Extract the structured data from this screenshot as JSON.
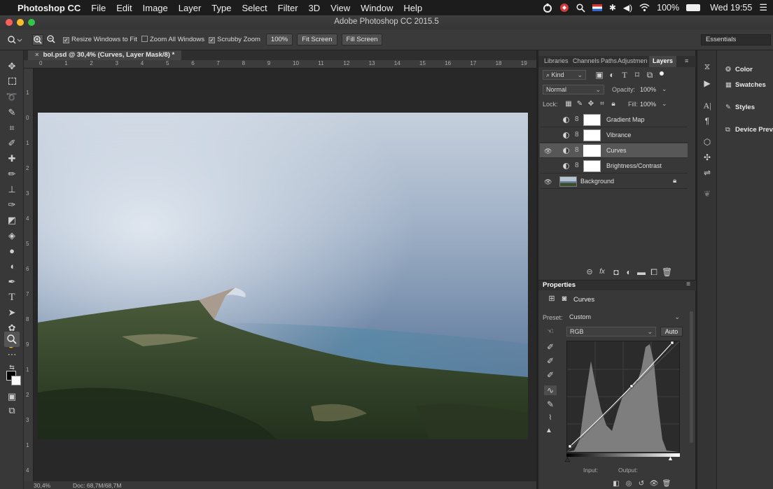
{
  "menubar": {
    "apple": "",
    "app_name": "Photoshop CC",
    "items": [
      "File",
      "Edit",
      "Image",
      "Layer",
      "Type",
      "Select",
      "Filter",
      "3D",
      "View",
      "Window",
      "Help"
    ],
    "battery": "100%",
    "clock": "Wed 19:55"
  },
  "window": {
    "title": "Adobe Photoshop CC 2015.5"
  },
  "options": {
    "resize_windows": "Resize Windows to Fit",
    "zoom_all": "Zoom All Windows",
    "scrubby": "Scrubby Zoom",
    "zoom_level": "100%",
    "fit_screen": "Fit Screen",
    "fill_screen": "Fill Screen",
    "workspace": "Essentials"
  },
  "document": {
    "tab_title": "bol.psd @ 30,4% (Curves, Layer Mask/8) *",
    "zoom": "30,4%",
    "doc_info": "Doc: 68,7M/68,7M"
  },
  "ruler": {
    "h_ticks": [
      "0",
      "1",
      "2",
      "3",
      "4",
      "5",
      "6",
      "7",
      "8",
      "9",
      "10",
      "11",
      "12",
      "13",
      "14",
      "15",
      "16",
      "17",
      "18",
      "19"
    ],
    "v_ticks": [
      "1",
      "0",
      "1",
      "2",
      "3",
      "4",
      "5",
      "6",
      "7",
      "8",
      "9",
      "1",
      "2",
      "3",
      "1",
      "4"
    ]
  },
  "panel_tabs": [
    "Libraries",
    "Channels",
    "Paths",
    "Adjustmen",
    "Layers"
  ],
  "layers": {
    "filter_label": "Kind",
    "blend_mode": "Normal",
    "opacity_label": "Opacity:",
    "opacity": "100%",
    "lock_label": "Lock:",
    "fill_label": "Fill:",
    "fill": "100%",
    "items": [
      {
        "name": "Gradient Map",
        "visible": false
      },
      {
        "name": "Vibrance",
        "visible": false
      },
      {
        "name": "Curves",
        "visible": true,
        "selected": true
      },
      {
        "name": "Brightness/Contrast",
        "visible": false
      },
      {
        "name": "Background",
        "visible": true,
        "locked": true
      }
    ]
  },
  "properties": {
    "title": "Properties",
    "panel_name": "Curves",
    "preset_label": "Preset:",
    "preset": "Custom",
    "channel": "RGB",
    "auto": "Auto",
    "input_label": "Input:",
    "output_label": "Output:"
  },
  "right_panel": {
    "items": [
      "Color",
      "Swatches",
      "Styles",
      "Device Prev..."
    ]
  },
  "colors": {
    "menubar_bg": "#1c1c1c",
    "panel_bg": "#383838",
    "selection": "#575757"
  }
}
